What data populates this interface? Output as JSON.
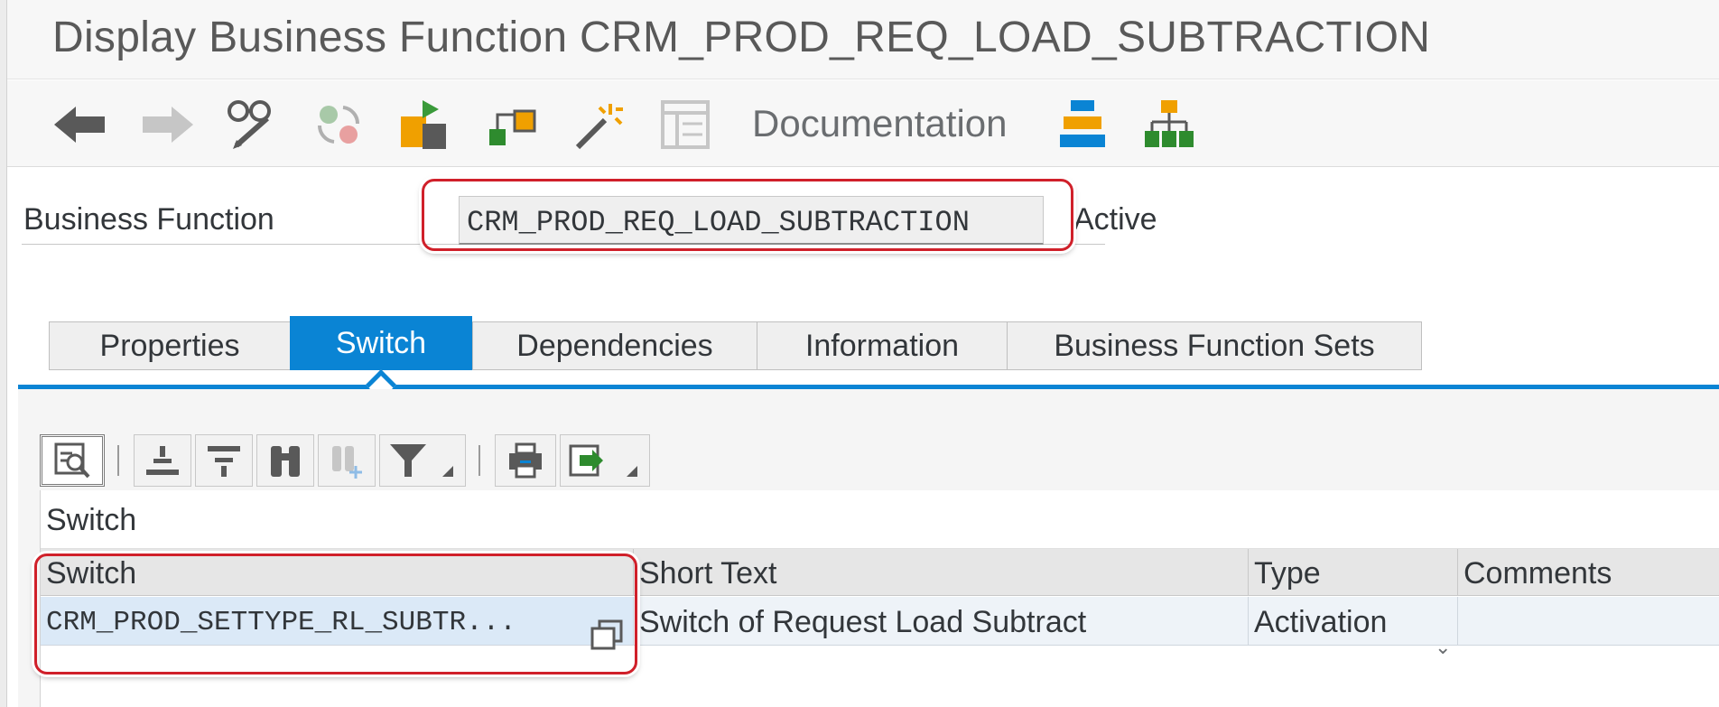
{
  "window": {
    "title": "Display Business Function CRM_PROD_REQ_LOAD_SUBTRACTION"
  },
  "toolbar": {
    "buttons": [
      {
        "name": "back-icon"
      },
      {
        "name": "forward-icon"
      },
      {
        "name": "display-change-icon"
      },
      {
        "name": "switch-icon"
      },
      {
        "name": "transport-icon"
      },
      {
        "name": "where-used-icon"
      },
      {
        "name": "magic-wand-icon"
      },
      {
        "name": "layout-icon"
      },
      {
        "name": "hierarchy-icon"
      },
      {
        "name": "tree-icon"
      }
    ],
    "documentation_label": "Documentation"
  },
  "business_function": {
    "label": "Business Function",
    "value": "CRM_PROD_REQ_LOAD_SUBTRACTION",
    "status": "Active"
  },
  "tabs": [
    {
      "label": "Properties",
      "selected": false
    },
    {
      "label": "Switch",
      "selected": true
    },
    {
      "label": "Dependencies",
      "selected": false
    },
    {
      "label": "Information",
      "selected": false
    },
    {
      "label": "Business Function Sets",
      "selected": false
    }
  ],
  "grid": {
    "caption": "Switch",
    "toolbar_icons": [
      "details-icon",
      "sort-ascending-icon",
      "sort-descending-icon",
      "find-icon",
      "find-next-icon",
      "filter-icon",
      "print-icon",
      "export-icon"
    ],
    "columns": [
      "Switch",
      "Short Text",
      "Type",
      "Comments"
    ],
    "rows": [
      {
        "switch": "CRM_PROD_SETTYPE_RL_SUBTR...",
        "short_text": "Switch of Request Load Subtract",
        "type": "Activation",
        "comments": ""
      }
    ]
  },
  "colors": {
    "accent": "#0a84d4",
    "highlight": "#d0202a"
  }
}
